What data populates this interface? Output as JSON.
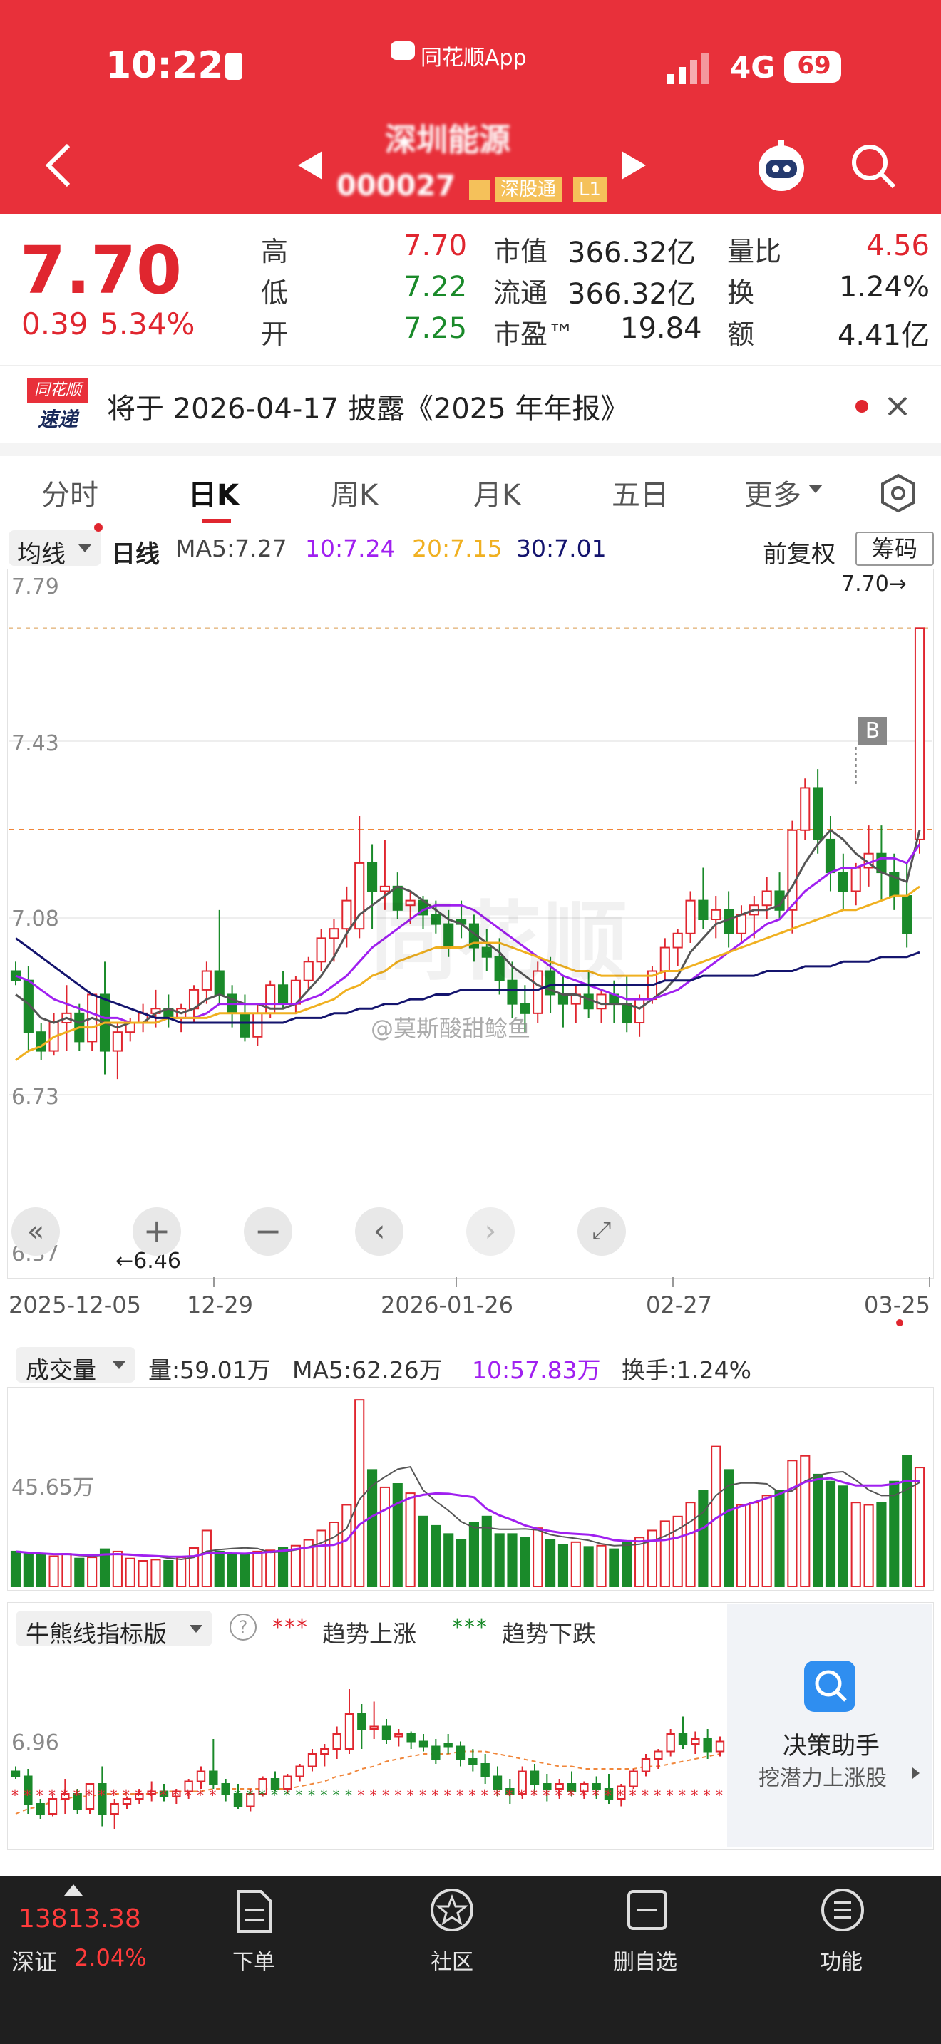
{
  "status_bar": {
    "time": "10:22",
    "app_label": "同花顺App",
    "network": "4G",
    "battery": "69"
  },
  "header": {
    "stock_name": "深圳能源",
    "stock_code": "000027",
    "badge_connect": "深股通",
    "badge_level": "L1"
  },
  "quote": {
    "price": "7.70",
    "change": "0.39",
    "change_pct": "5.34%",
    "high_label": "高",
    "high": "7.70",
    "low_label": "低",
    "low": "7.22",
    "open_label": "开",
    "open": "7.25",
    "mktcap_label": "市值",
    "mktcap": "366.32亿",
    "float_label": "流通",
    "float": "366.32亿",
    "pe_label": "市盈™",
    "pe": "19.84",
    "volratio_label": "量比",
    "volratio": "4.56",
    "turnover_label": "换",
    "turnover": "1.24%",
    "amount_label": "额",
    "amount": "4.41亿"
  },
  "notice": {
    "logo_top": "同花顺",
    "logo_bottom": "速递",
    "text": "将于 2026-04-17 披露《2025 年年报》"
  },
  "tabs": [
    {
      "label": "分时",
      "active": false
    },
    {
      "label": "日K",
      "active": true
    },
    {
      "label": "周K",
      "active": false
    },
    {
      "label": "月K",
      "active": false
    },
    {
      "label": "五日",
      "active": false
    },
    {
      "label": "更多",
      "active": false
    }
  ],
  "chart_toolbar": {
    "indicator": "均线",
    "period": "日线",
    "ma5": "MA5:7.27",
    "ma10": "10:7.24",
    "ma20": "20:7.15",
    "ma30": "30:7.01",
    "adjust": "前复权",
    "chips": "筹码"
  },
  "price_axis": {
    "labels": [
      "7.79",
      "7.43",
      "7.08",
      "6.73",
      "6.37"
    ],
    "high_marker": "7.70→",
    "low_marker": "←6.46"
  },
  "date_axis": [
    "2025-12-05",
    "12-29",
    "2026-01-26",
    "02-27",
    "03-25"
  ],
  "watermark": "同花顺",
  "weibo_watermark": "@莫斯酸甜鲶鱼",
  "buy_marker": "B",
  "volume_toolbar": {
    "indicator": "成交量",
    "vol": "量:59.01万",
    "ma5": "MA5:62.26万",
    "ma10": "10:57.83万",
    "turnover": "换手:1.24%",
    "axis_label": "45.65万"
  },
  "bull_bear": {
    "indicator": "牛熊线指标版",
    "up_label": "趋势上涨",
    "down_label": "趋势下跌",
    "axis_label": "6.96",
    "assistant_title": "决策助手",
    "assistant_sub": "挖潜力上涨股"
  },
  "bottom_nav": {
    "index_value": "13813.38",
    "index_name": "深证",
    "index_change": "2.04%",
    "items": [
      "下单",
      "社区",
      "删自选",
      "功能"
    ]
  },
  "colors": {
    "up": "#e0262f",
    "down": "#1a8a2a",
    "ma5": "#555555",
    "ma10": "#a020f0",
    "ma20": "#f0b020",
    "ma30": "#14146e",
    "header": "#e8303a"
  },
  "chart_data": {
    "type": "candlestick",
    "ylim": [
      6.37,
      7.79
    ],
    "series": [
      {
        "name": "K",
        "ohlc": [
          [
            6.97,
            6.99,
            6.94,
            6.95
          ],
          [
            6.95,
            6.98,
            6.8,
            6.84
          ],
          [
            6.84,
            6.86,
            6.78,
            6.8
          ],
          [
            6.8,
            6.88,
            6.79,
            6.86
          ],
          [
            6.86,
            6.94,
            6.8,
            6.88
          ],
          [
            6.88,
            6.9,
            6.8,
            6.82
          ],
          [
            6.82,
            6.92,
            6.8,
            6.92
          ],
          [
            6.92,
            6.99,
            6.75,
            6.8
          ],
          [
            6.8,
            6.86,
            6.74,
            6.84
          ],
          [
            6.84,
            6.87,
            6.82,
            6.86
          ],
          [
            6.86,
            6.9,
            6.84,
            6.88
          ],
          [
            6.88,
            6.93,
            6.85,
            6.89
          ],
          [
            6.89,
            6.92,
            6.85,
            6.87
          ],
          [
            6.87,
            6.9,
            6.84,
            6.89
          ],
          [
            6.89,
            6.94,
            6.86,
            6.93
          ],
          [
            6.93,
            6.99,
            6.9,
            6.97
          ],
          [
            6.97,
            7.1,
            6.9,
            6.92
          ],
          [
            6.92,
            6.94,
            6.85,
            6.88
          ],
          [
            6.88,
            6.92,
            6.82,
            6.83
          ],
          [
            6.83,
            6.9,
            6.81,
            6.88
          ],
          [
            6.88,
            6.95,
            6.87,
            6.94
          ],
          [
            6.94,
            6.97,
            6.89,
            6.9
          ],
          [
            6.9,
            6.96,
            6.88,
            6.95
          ],
          [
            6.95,
            7.0,
            6.93,
            6.99
          ],
          [
            6.99,
            7.06,
            6.97,
            7.04
          ],
          [
            7.04,
            7.08,
            6.99,
            7.06
          ],
          [
            7.06,
            7.15,
            7.02,
            7.12
          ],
          [
            7.06,
            7.3,
            7.04,
            7.2
          ],
          [
            7.2,
            7.24,
            7.06,
            7.14
          ],
          [
            7.14,
            7.25,
            7.1,
            7.15
          ],
          [
            7.15,
            7.18,
            7.08,
            7.1
          ],
          [
            7.11,
            7.14,
            7.07,
            7.12
          ],
          [
            7.12,
            7.13,
            7.06,
            7.09
          ],
          [
            7.09,
            7.12,
            7.05,
            7.07
          ],
          [
            7.07,
            7.1,
            7.0,
            7.02
          ],
          [
            7.08,
            7.12,
            7.04,
            7.07
          ],
          [
            7.07,
            7.09,
            6.99,
            7.02
          ],
          [
            7.02,
            7.06,
            6.97,
            7.0
          ],
          [
            7.0,
            7.04,
            6.92,
            6.95
          ],
          [
            6.95,
            6.99,
            6.87,
            6.9
          ],
          [
            6.9,
            6.94,
            6.84,
            6.88
          ],
          [
            6.88,
            6.99,
            6.86,
            6.97
          ],
          [
            6.97,
            7.0,
            6.88,
            6.92
          ],
          [
            6.92,
            6.96,
            6.85,
            6.9
          ],
          [
            6.9,
            6.94,
            6.86,
            6.92
          ],
          [
            6.92,
            6.97,
            6.87,
            6.89
          ],
          [
            6.89,
            6.93,
            6.86,
            6.92
          ],
          [
            6.92,
            6.95,
            6.86,
            6.9
          ],
          [
            6.9,
            6.96,
            6.84,
            6.86
          ],
          [
            6.86,
            6.92,
            6.83,
            6.91
          ],
          [
            6.91,
            6.98,
            6.9,
            6.97
          ],
          [
            6.97,
            7.04,
            6.95,
            7.02
          ],
          [
            7.02,
            7.06,
            6.98,
            7.05
          ],
          [
            7.05,
            7.14,
            7.03,
            7.12
          ],
          [
            7.12,
            7.19,
            7.06,
            7.08
          ],
          [
            7.08,
            7.13,
            7.04,
            7.1
          ],
          [
            7.1,
            7.14,
            7.02,
            7.05
          ],
          [
            7.05,
            7.11,
            7.03,
            7.09
          ],
          [
            7.09,
            7.13,
            7.04,
            7.11
          ],
          [
            7.11,
            7.17,
            7.08,
            7.14
          ],
          [
            7.14,
            7.18,
            7.08,
            7.1
          ],
          [
            7.1,
            7.29,
            7.05,
            7.27
          ],
          [
            7.27,
            7.38,
            7.25,
            7.36
          ],
          [
            7.36,
            7.4,
            7.22,
            7.25
          ],
          [
            7.25,
            7.3,
            7.14,
            7.18
          ],
          [
            7.18,
            7.22,
            7.1,
            7.14
          ],
          [
            7.14,
            7.2,
            7.11,
            7.19
          ],
          [
            7.19,
            7.28,
            7.15,
            7.22
          ],
          [
            7.22,
            7.28,
            7.12,
            7.18
          ],
          [
            7.18,
            7.22,
            7.1,
            7.13
          ],
          [
            7.13,
            7.2,
            7.02,
            7.05
          ],
          [
            7.25,
            7.7,
            7.22,
            7.7
          ]
        ]
      }
    ],
    "ma": {
      "ma5": [
        6.92,
        6.9,
        6.87,
        6.86,
        6.87,
        6.86,
        6.87,
        6.86,
        6.85,
        6.86,
        6.86,
        6.88,
        6.89,
        6.88,
        6.89,
        6.91,
        6.92,
        6.91,
        6.9,
        6.9,
        6.89,
        6.89,
        6.9,
        6.93,
        6.96,
        7.0,
        7.05,
        7.09,
        7.11,
        7.13,
        7.15,
        7.14,
        7.12,
        7.1,
        7.08,
        7.07,
        7.05,
        7.03,
        7.01,
        6.98,
        6.96,
        6.94,
        6.93,
        6.92,
        6.92,
        6.91,
        6.9,
        6.9,
        6.9,
        6.89,
        6.91,
        6.93,
        6.96,
        7.01,
        7.04,
        7.07,
        7.08,
        7.09,
        7.1,
        7.1,
        7.11,
        7.15,
        7.2,
        7.24,
        7.27,
        7.25,
        7.22,
        7.2,
        7.18,
        7.17,
        7.16,
        7.27
      ],
      "ma10": [
        6.96,
        6.95,
        6.93,
        6.91,
        6.9,
        6.89,
        6.88,
        6.87,
        6.87,
        6.86,
        6.86,
        6.86,
        6.87,
        6.87,
        6.87,
        6.88,
        6.9,
        6.9,
        6.9,
        6.9,
        6.9,
        6.9,
        6.9,
        6.91,
        6.92,
        6.94,
        6.96,
        6.99,
        7.02,
        7.04,
        7.06,
        7.08,
        7.1,
        7.11,
        7.11,
        7.11,
        7.1,
        7.08,
        7.06,
        7.04,
        7.02,
        7.0,
        6.98,
        6.96,
        6.95,
        6.94,
        6.93,
        6.92,
        6.91,
        6.91,
        6.91,
        6.92,
        6.93,
        6.95,
        6.97,
        6.99,
        7.01,
        7.03,
        7.05,
        7.07,
        7.08,
        7.11,
        7.14,
        7.16,
        7.18,
        7.19,
        7.19,
        7.2,
        7.21,
        7.21,
        7.2,
        7.24
      ],
      "ma20": [
        6.78,
        6.8,
        6.81,
        6.83,
        6.84,
        6.85,
        6.85,
        6.86,
        6.86,
        6.86,
        6.86,
        6.86,
        6.87,
        6.87,
        6.87,
        6.87,
        6.88,
        6.88,
        6.88,
        6.88,
        6.88,
        6.88,
        6.88,
        6.89,
        6.9,
        6.91,
        6.93,
        6.94,
        6.96,
        6.97,
        6.99,
        7.0,
        7.01,
        7.02,
        7.02,
        7.02,
        7.03,
        7.03,
        7.03,
        7.02,
        7.01,
        7.0,
        6.99,
        6.98,
        6.97,
        6.97,
        6.96,
        6.96,
        6.96,
        6.96,
        6.96,
        6.97,
        6.97,
        6.98,
        6.99,
        7.0,
        7.01,
        7.02,
        7.03,
        7.04,
        7.05,
        7.06,
        7.07,
        7.08,
        7.09,
        7.1,
        7.1,
        7.11,
        7.12,
        7.13,
        7.13,
        7.15
      ],
      "ma30": [
        7.04,
        7.02,
        7.0,
        6.98,
        6.96,
        6.94,
        6.92,
        6.91,
        6.9,
        6.89,
        6.88,
        6.87,
        6.87,
        6.86,
        6.86,
        6.86,
        6.86,
        6.86,
        6.86,
        6.86,
        6.86,
        6.86,
        6.87,
        6.87,
        6.87,
        6.88,
        6.88,
        6.89,
        6.89,
        6.9,
        6.9,
        6.91,
        6.91,
        6.92,
        6.92,
        6.93,
        6.93,
        6.93,
        6.93,
        6.93,
        6.93,
        6.93,
        6.94,
        6.94,
        6.94,
        6.94,
        6.94,
        6.94,
        6.94,
        6.94,
        6.94,
        6.95,
        6.95,
        6.95,
        6.96,
        6.96,
        6.96,
        6.96,
        6.96,
        6.97,
        6.97,
        6.97,
        6.98,
        6.98,
        6.98,
        6.99,
        6.99,
        6.99,
        7.0,
        7.0,
        7.0,
        7.01
      ]
    },
    "volume": [
      30,
      28,
      27,
      26,
      28,
      24,
      25,
      32,
      30,
      24,
      22,
      23,
      22,
      25,
      33,
      48,
      30,
      27,
      28,
      30,
      31,
      33,
      35,
      40,
      48,
      55,
      70,
      160,
      100,
      85,
      88,
      80,
      60,
      52,
      45,
      40,
      55,
      60,
      45,
      45,
      42,
      50,
      40,
      36,
      38,
      34,
      35,
      32,
      38,
      42,
      48,
      56,
      60,
      72,
      82,
      120,
      100,
      70,
      72,
      78,
      82,
      108,
      112,
      96,
      90,
      86,
      72,
      70,
      72,
      90,
      112,
      102
    ]
  }
}
